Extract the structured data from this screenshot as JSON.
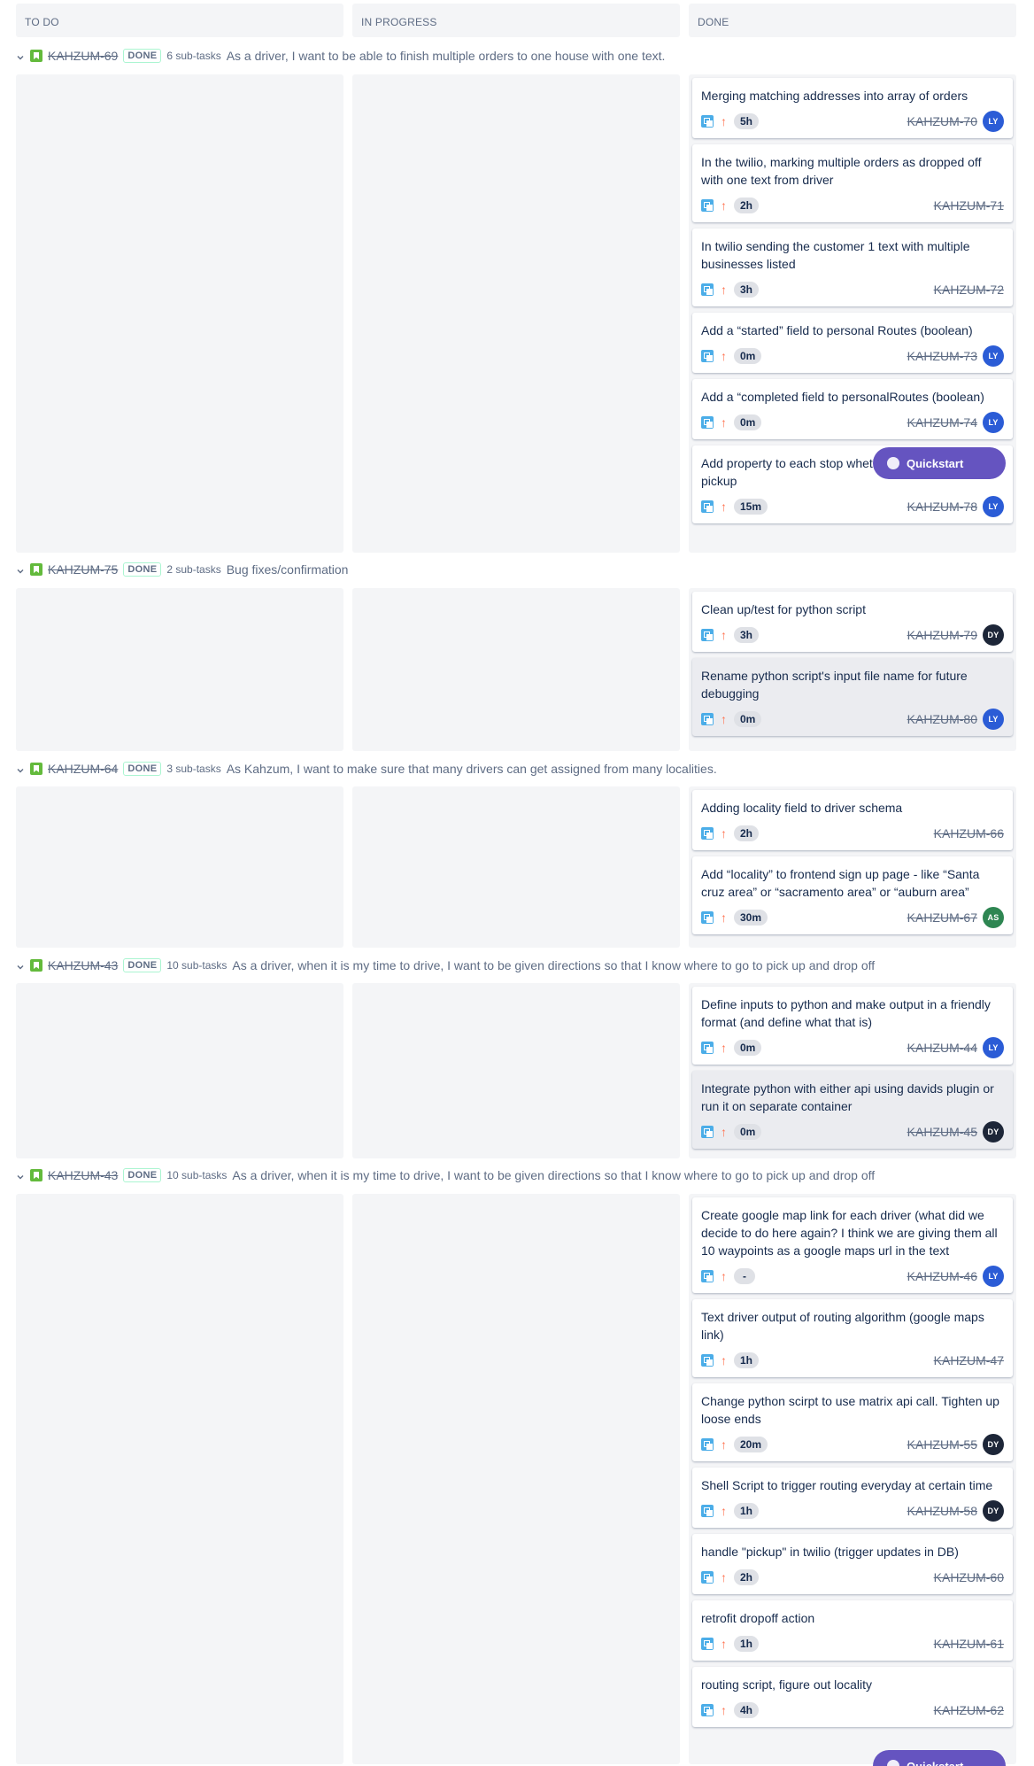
{
  "columns": {
    "todo": "TO DO",
    "in_progress": "IN PROGRESS",
    "done": "DONE"
  },
  "colors": {
    "avatar_ly": "#2b5cd6",
    "avatar_dy": "#1d2638",
    "avatar_as": "#2e8652",
    "story": "#63ba3c",
    "subtask": "#4bade8",
    "priority": "#ff7452",
    "quickstart": "#6554c0"
  },
  "quickstart_label": "Quickstart",
  "swimlanes": [
    {
      "key": "KAHZUM-69",
      "status": "DONE",
      "subtasks": "6 sub-tasks",
      "summary": "As a driver, I want to be able to finish multiple orders to one house with one text.",
      "cards": [
        {
          "title": "Merging matching addresses into array of orders",
          "estimate": "5h",
          "key": "KAHZUM-70",
          "avatar": "LY"
        },
        {
          "title": "In the twilio, marking multiple orders as dropped off with one text from driver",
          "estimate": "2h",
          "key": "KAHZUM-71",
          "avatar": ""
        },
        {
          "title": "In twilio sending the customer 1 text with multiple businesses listed",
          "estimate": "3h",
          "key": "KAHZUM-72",
          "avatar": ""
        },
        {
          "title": "Add a “started” field to personal Routes (boolean)",
          "estimate": "0m",
          "key": "KAHZUM-73",
          "avatar": "LY"
        },
        {
          "title": "Add a “completed field to personalRoutes (boolean)",
          "estimate": "0m",
          "key": "KAHZUM-74",
          "avatar": "LY"
        },
        {
          "title": "Add property to each stop whether it's a dropoff or a pickup",
          "estimate": "15m",
          "key": "KAHZUM-78",
          "avatar": "LY"
        }
      ]
    },
    {
      "key": "KAHZUM-75",
      "status": "DONE",
      "subtasks": "2 sub-tasks",
      "summary": "Bug fixes/confirmation",
      "cards": [
        {
          "title": "Clean up/test for python script",
          "estimate": "3h",
          "key": "KAHZUM-79",
          "avatar": "DY"
        },
        {
          "title": "Rename python script's input file name for future debugging",
          "estimate": "0m",
          "key": "KAHZUM-80",
          "avatar": "LY"
        }
      ]
    },
    {
      "key": "KAHZUM-64",
      "status": "DONE",
      "subtasks": "3 sub-tasks",
      "summary": "As Kahzum, I want to make sure that many drivers can get assigned from many localities.",
      "cards": [
        {
          "title": "Adding locality field to driver schema",
          "estimate": "2h",
          "key": "KAHZUM-66",
          "avatar": ""
        },
        {
          "title": "Add “locality” to frontend sign up page - like “Santa cruz area” or “sacramento area” or “auburn area”",
          "estimate": "30m",
          "key": "KAHZUM-67",
          "avatar": "AS"
        }
      ]
    },
    {
      "key": "KAHZUM-43",
      "status": "DONE",
      "subtasks": "10 sub-tasks",
      "summary": "As a driver, when it is my time to drive, I want to be given directions so that I know where to go to pick up and drop off",
      "cards": [
        {
          "title": "Define inputs to python and make output in a friendly format (and define what that is)",
          "estimate": "0m",
          "key": "KAHZUM-44",
          "avatar": "LY"
        },
        {
          "title": "Integrate python with either api using davids plugin or run it on separate container",
          "estimate": "0m",
          "key": "KAHZUM-45",
          "avatar": "DY"
        }
      ]
    },
    {
      "key": "KAHZUM-43",
      "status": "DONE",
      "subtasks": "10 sub-tasks",
      "summary": "As a driver, when it is my time to drive, I want to be given directions so that I know where to go to pick up and drop off",
      "cards": [
        {
          "title": "Create google map link for each driver (what did we decide to do here again? I think we are giving them all 10 waypoints as a google maps url in the text",
          "estimate": "-",
          "key": "KAHZUM-46",
          "avatar": "LY"
        },
        {
          "title": "Text driver output of routing algorithm (google maps link)",
          "estimate": "1h",
          "key": "KAHZUM-47",
          "avatar": ""
        },
        {
          "title": "Change python scirpt to use matrix api call. Tighten up loose ends",
          "estimate": "20m",
          "key": "KAHZUM-55",
          "avatar": "DY"
        },
        {
          "title": "Shell Script to trigger routing everyday at certain time",
          "estimate": "1h",
          "key": "KAHZUM-58",
          "avatar": "DY"
        },
        {
          "title": "handle \"pickup\" in twilio (trigger updates in DB)",
          "estimate": "2h",
          "key": "KAHZUM-60",
          "avatar": ""
        },
        {
          "title": "retrofit dropoff action",
          "estimate": "1h",
          "key": "KAHZUM-61",
          "avatar": ""
        },
        {
          "title": "routing script, figure out locality",
          "estimate": "4h",
          "key": "KAHZUM-62",
          "avatar": ""
        }
      ]
    }
  ]
}
